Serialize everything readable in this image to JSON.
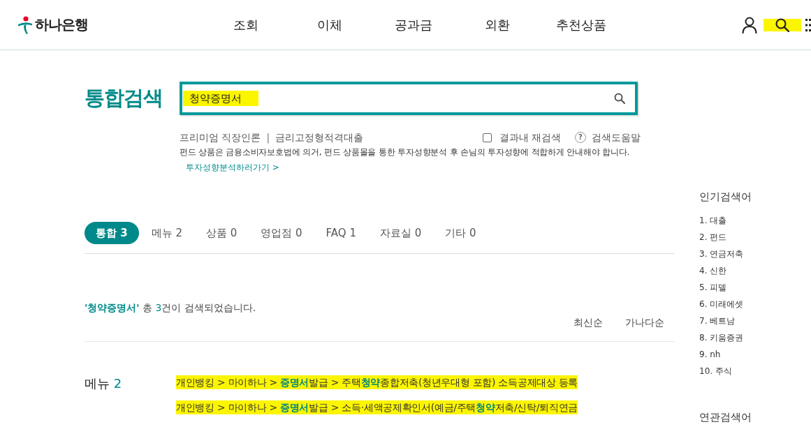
{
  "header": {
    "logo": {
      "text": "하나은행"
    },
    "nav": [
      "조회",
      "이체",
      "공과금",
      "외환",
      "추천상품"
    ],
    "icons": [
      {
        "kind": "user",
        "highlighted": false
      },
      {
        "kind": "search",
        "highlighted": true
      },
      {
        "kind": "grid",
        "highlighted": false
      }
    ]
  },
  "search": {
    "title": "통합검색",
    "value": "청약증명서",
    "highlighted": true
  },
  "quick_links": [
    "프리미엄 직장인론",
    "금리고정형적격대출"
  ],
  "quick_links_separator": "|",
  "research_option": {
    "label": "결과내 재검색",
    "checked": false
  },
  "help": {
    "icon": "?",
    "label": "검색도움말"
  },
  "notice": "펀드 상품은 금융소비자보호법에 의거, 펀드 상품몰을 통한 투자성향분석 후 손님의 투자성향에 적합하게 안내해야 합니다.",
  "notice_link": "투자성향분석하러가기 >",
  "tabs": [
    {
      "label": "통합 3",
      "selected": true
    },
    {
      "label": "메뉴 2",
      "selected": false
    },
    {
      "label": "상품 0",
      "selected": false
    },
    {
      "label": "영업점 0",
      "selected": false
    },
    {
      "label": "FAQ 1",
      "selected": false
    },
    {
      "label": "자료실 0",
      "selected": false
    },
    {
      "label": "기타 0",
      "selected": false
    }
  ],
  "summary": {
    "query": "'청약증명서'",
    "middle": "총",
    "count": "3",
    "suffix": "건이 검색되었습니다."
  },
  "sort_options": [
    "최신순",
    "가나다순"
  ],
  "menu_section": {
    "title": "메뉴",
    "count": "2",
    "results": [
      {
        "text": "개인뱅킹 > 마이하나 > **증명서**발급 > 주택**청약**종합저축(청년우대형 포함) 소득공제대상 등록",
        "highlighted": true
      },
      {
        "text": "개인뱅킹 > 마이하나 > **증명서**발급 > 소득·세액공제확인서(예금/주택**청약**저축/신탁/퇴직연금",
        "highlighted": true
      }
    ]
  },
  "sidebar": {
    "popular_title": "인기검색어",
    "popular": [
      "1. 대출",
      "2. 펀드",
      "3. 연금저축",
      "4. 신한",
      "5. 피델",
      "6. 미래에셋",
      "7. 베트남",
      "8. 키움증권",
      "9. nh",
      "10. 주식"
    ],
    "related_title": "연관검색어"
  }
}
